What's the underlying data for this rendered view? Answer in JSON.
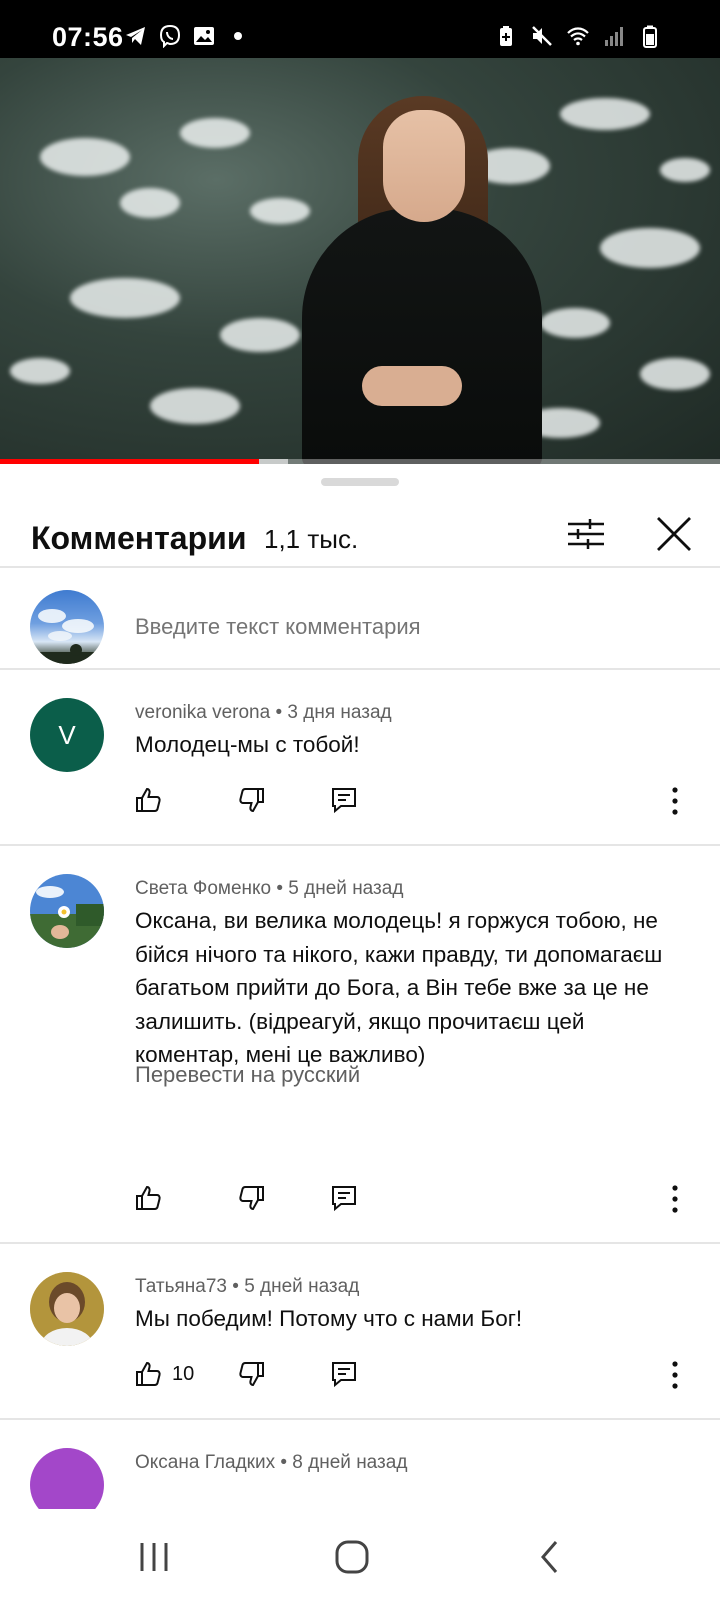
{
  "status_bar": {
    "time": "07:56",
    "left_icons": [
      "telegram-icon",
      "viber-icon",
      "gallery-icon",
      "notification-dot-icon"
    ],
    "right_icons": [
      "battery-saver-icon",
      "mute-icon",
      "wifi-icon",
      "signal-icon",
      "battery-icon"
    ]
  },
  "video": {
    "progress_fraction": 0.36,
    "buffer_fraction": 0.4
  },
  "comments_panel": {
    "title": "Комментарии",
    "count": "1,1 тыс.",
    "input_placeholder": "Введите текст комментария"
  },
  "comments": [
    {
      "author": "veronika verona",
      "time": "3 дня назад",
      "meta": "veronika verona • 3 дня назад",
      "avatar_letter": "V",
      "avatar_color": "#0b5e4a",
      "text": "Молодец-мы с тобой!",
      "likes": ""
    },
    {
      "author": "Света Фоменко",
      "time": "5 дней назад",
      "meta": "Света Фоменко • 5 дней назад",
      "text": "Оксана, ви велика молодець! я горжуся тобою, не бійся нічого та нікого, кажи правду, ти допомагаєш багатьом прийти до Бога, а Він тебе вже за це не залишить. (відреагуй, якщо прочитаєш цей коментар, мені це важливо)",
      "translate_label": "Перевести на русский",
      "likes": ""
    },
    {
      "author": "Татьяна73",
      "time": "5 дней назад",
      "meta": "Татьяна73 • 5 дней назад",
      "text": "Мы победим! Потому что с нами Бог!",
      "likes": "10"
    },
    {
      "author": "Оксана Гладких",
      "time": "8 дней назад",
      "meta": "Оксана Гладких • 8 дней назад",
      "avatar_color": "#a347c9"
    }
  ],
  "colors": {
    "accent_red": "#ff0000",
    "text_primary": "#0f0f0f",
    "text_secondary": "#606060",
    "divider": "#e5e5e5"
  }
}
